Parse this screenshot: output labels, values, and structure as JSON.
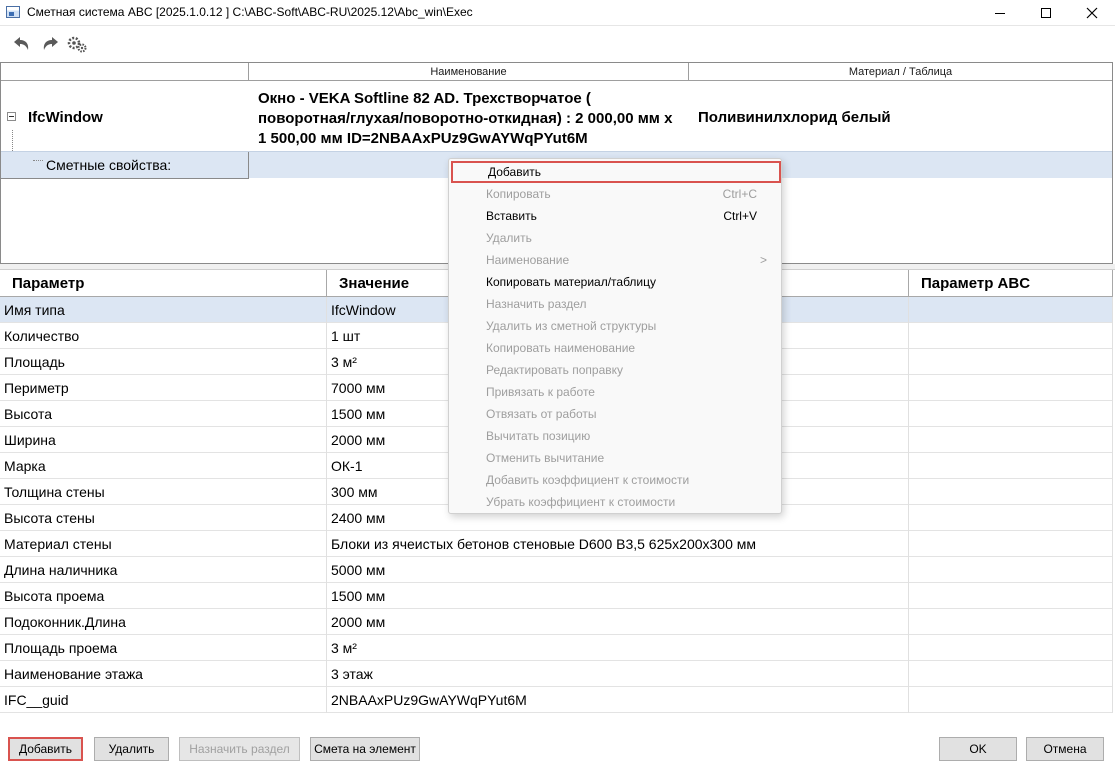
{
  "window": {
    "title": "Сметная система ABC [2025.1.0.12 ]   C:\\ABC-Soft\\ABC-RU\\2025.12\\Abc_win\\Exec",
    "minimize": "—",
    "maximize": "☐",
    "close": "✕"
  },
  "toolbar": {
    "undo_icon": "undo-icon",
    "redo_icon": "redo-icon",
    "settings_icon": "settings-icon"
  },
  "tree": {
    "columns": [
      "",
      "Наименование",
      "Материал / Таблица"
    ],
    "root": {
      "label": "IfcWindow",
      "name": "Окно - VEKA Softline 82 AD. Трехстворчатое ( поворотная/глухая/поворотно-откидная)  : 2 000,00 мм x 1 500,00 мм  ID=2NBAAxPUz9GwAYWqPYut6M",
      "material": "Поливинилхлорид белый"
    },
    "child": {
      "label": "Сметные свойства:"
    }
  },
  "context_menu": {
    "items": [
      {
        "label": "Добавить",
        "shortcut": "",
        "disabled": false,
        "highlighted": true
      },
      {
        "label": "Копировать",
        "shortcut": "Ctrl+C",
        "disabled": true
      },
      {
        "label": "Вставить",
        "shortcut": "Ctrl+V",
        "disabled": false
      },
      {
        "label": "Удалить",
        "shortcut": "",
        "disabled": true
      },
      {
        "label": "Наименование",
        "shortcut": "",
        "disabled": true,
        "submenu": ">"
      },
      {
        "label": "Копировать материал/таблицу",
        "shortcut": "",
        "disabled": false
      },
      {
        "label": "Назначить раздел",
        "shortcut": "",
        "disabled": true
      },
      {
        "label": "Удалить из сметной структуры",
        "shortcut": "",
        "disabled": true
      },
      {
        "label": "Копировать наименование",
        "shortcut": "",
        "disabled": true
      },
      {
        "label": "Редактировать поправку",
        "shortcut": "",
        "disabled": true
      },
      {
        "label": "Привязать к работе",
        "shortcut": "",
        "disabled": true
      },
      {
        "label": "Отвязать от работы",
        "shortcut": "",
        "disabled": true
      },
      {
        "label": "Вычитать позицию",
        "shortcut": "",
        "disabled": true
      },
      {
        "label": "Отменить вычитание",
        "shortcut": "",
        "disabled": true
      },
      {
        "label": "Добавить коэффициент к стоимости",
        "shortcut": "",
        "disabled": true
      },
      {
        "label": "Убрать коэффициент к стоимости",
        "shortcut": "",
        "disabled": true
      }
    ]
  },
  "params": {
    "headers": [
      "Параметр",
      "Значение",
      "Параметр ABC"
    ],
    "rows": [
      {
        "name": "Имя типа",
        "value": "IfcWindow",
        "abc": ""
      },
      {
        "name": "Количество",
        "value": "1  шт",
        "abc": ""
      },
      {
        "name": "Площадь",
        "value": "3  м²",
        "abc": ""
      },
      {
        "name": "Периметр",
        "value": "7000  мм",
        "abc": ""
      },
      {
        "name": "Высота",
        "value": "1500  мм",
        "abc": ""
      },
      {
        "name": "Ширина",
        "value": "2000  мм",
        "abc": ""
      },
      {
        "name": "Марка",
        "value": "ОК-1",
        "abc": ""
      },
      {
        "name": "Толщина стены",
        "value": "300  мм",
        "abc": ""
      },
      {
        "name": "Высота стены",
        "value": "2400  мм",
        "abc": ""
      },
      {
        "name": "Материал стены",
        "value": "Блоки из ячеистых бетонов стеновые D600 B3,5 625x200x300 мм",
        "abc": ""
      },
      {
        "name": "Длина наличника",
        "value": "5000  мм",
        "abc": ""
      },
      {
        "name": "Высота проема",
        "value": "1500  мм",
        "abc": ""
      },
      {
        "name": "Подоконник.Длина",
        "value": "2000  мм",
        "abc": ""
      },
      {
        "name": "Площадь проема",
        "value": "3  м²",
        "abc": ""
      },
      {
        "name": "Наименование этажа",
        "value": "3 этаж",
        "abc": ""
      },
      {
        "name": "IFC__guid",
        "value": "2NBAAxPUz9GwAYWqPYut6M",
        "abc": ""
      }
    ]
  },
  "buttons": {
    "add": "Добавить",
    "delete": "Удалить",
    "assign_section": "Назначить раздел",
    "estimate_element": "Смета на элемент",
    "ok": "OK",
    "cancel": "Отмена"
  },
  "colors": {
    "selection": "#dce6f3",
    "highlight_border": "#d9534f",
    "disabled_text": "#9e9e9e"
  }
}
